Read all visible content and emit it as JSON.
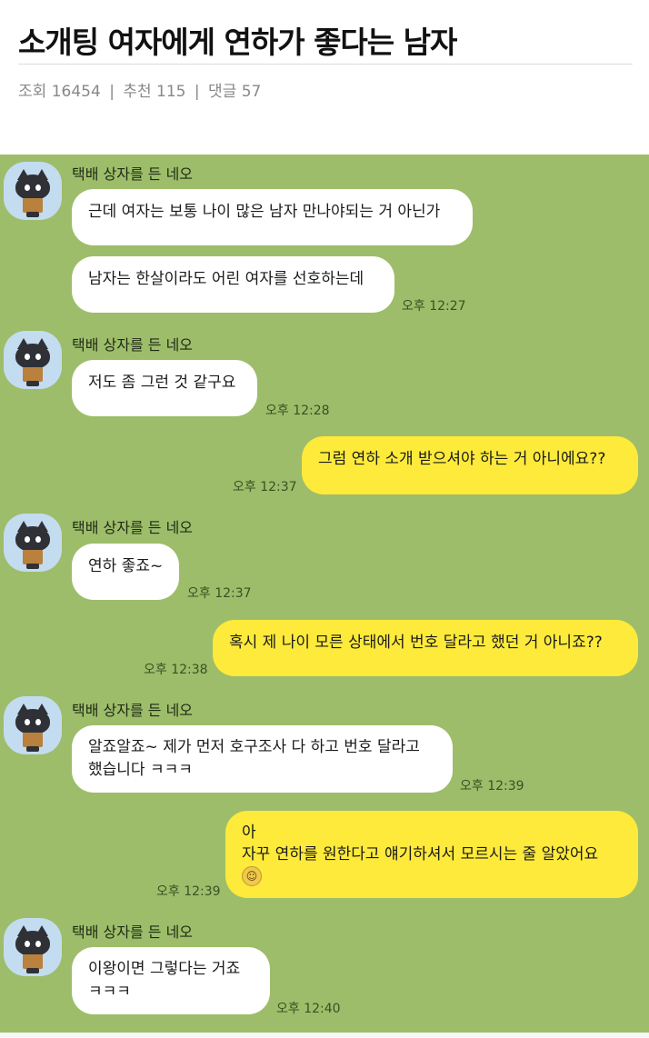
{
  "post": {
    "title": "소개팅 여자에게 연하가 좋다는 남자",
    "views_label": "조회",
    "views": "16454",
    "likes_label": "추천",
    "likes": "115",
    "comments_label": "댓글",
    "comments": "57"
  },
  "chat": {
    "sender_name": "택배 상자를 든 네오",
    "messages": [
      {
        "text": "근데 여자는 보통 나이 많은 남자 만나야되는 거 아닌가"
      },
      {
        "text": "남자는 한살이라도 어린 여자를 선호하는데",
        "time": "오후 12:27"
      },
      {
        "text": "저도 좀 그런 것 같구요",
        "time": "오후 12:28"
      },
      {
        "text": "그럼 연하 소개 받으셔야 하는 거 아니에요??",
        "time": "오후 12:37"
      },
      {
        "text": "연하 좋죠~",
        "time": "오후 12:37"
      },
      {
        "text": "혹시 제 나이 모른 상태에서 번호 달라고 했던 거 아니죠??",
        "time": "오후 12:38"
      },
      {
        "line1": "알죠알죠~ 제가 먼저 호구조사 다 하고 번호 달라고",
        "line2": "했습니다 ㅋㅋㅋ",
        "time": "오후 12:39"
      },
      {
        "line1": "아",
        "line2": "자꾸 연하를 원한다고 얘기하셔서 모르시는 줄 알았어요",
        "emoji": "smiling-face",
        "time": "오후 12:39"
      },
      {
        "line1": "이왕이면 그렇다는 거죠",
        "line2": "ㅋㅋㅋ",
        "time": "오후 12:40"
      }
    ]
  },
  "colors": {
    "chat_background": "#9dbd6a",
    "incoming_bubble": "#ffffff",
    "outgoing_bubble": "#fdea3b"
  }
}
